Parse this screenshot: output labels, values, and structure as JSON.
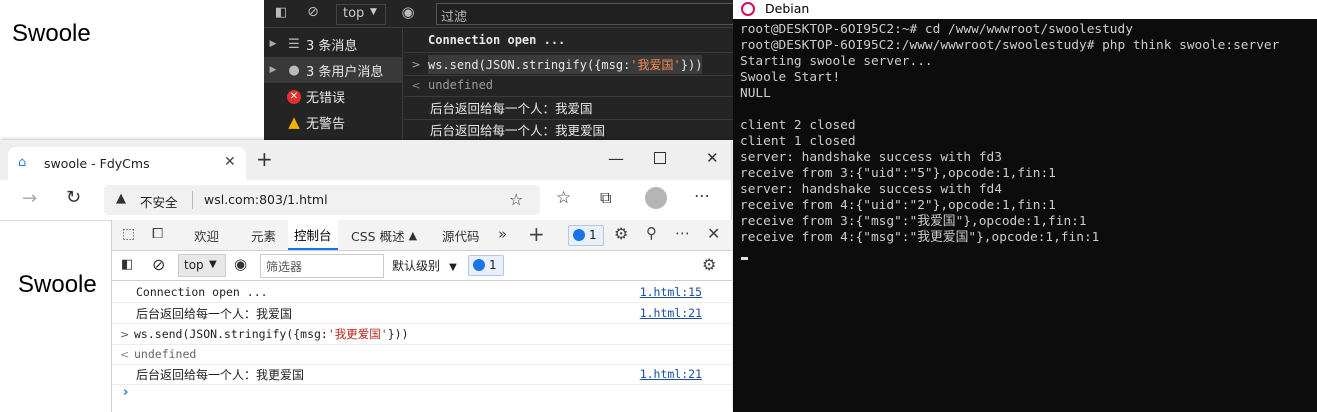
{
  "top_page": {
    "title": "Swoole"
  },
  "dark_devtools": {
    "toolbar": {
      "context": "top",
      "filter_placeholder": "过滤"
    },
    "sidebar": [
      {
        "label": "3 条消息",
        "icon": "list-icon"
      },
      {
        "label": "3 条用户消息",
        "icon": "user-icon",
        "selected": true
      },
      {
        "label": "无错误",
        "icon": "error-icon"
      },
      {
        "label": "无警告",
        "icon": "warning-icon"
      }
    ],
    "messages": [
      {
        "text": "Connection open ...",
        "kind": "log-bold"
      },
      {
        "prefix": ">",
        "code_pre": "ws.send(JSON.stringify({msg:",
        "code_str": "'我爱国'",
        "code_post": "}))",
        "kind": "input"
      },
      {
        "prefix": "<",
        "text": "undefined",
        "kind": "result"
      },
      {
        "text": "后台返回给每一个人：我爱国",
        "kind": "log"
      },
      {
        "text": "后台返回给每一个人：我更爱国",
        "kind": "log"
      }
    ]
  },
  "terminal": {
    "title": "Debian",
    "lines": [
      "root@DESKTOP-6OI95C2:~# cd /www/wwwroot/swoolestudy",
      "root@DESKTOP-6OI95C2:/www/wwwroot/swoolestudy# php think swoole:server",
      "Starting swoole server...",
      "Swoole Start!",
      "NULL",
      "",
      "client 2 closed",
      "client 1 closed",
      "server: handshake success with fd3",
      "receive from 3:{\"uid\":\"5\"},opcode:1,fin:1",
      "server: handshake success with fd4",
      "receive from 4:{\"uid\":\"2\"},opcode:1,fin:1",
      "receive from 3:{\"msg\":\"我爱国\"},opcode:1,fin:1",
      "receive from 4:{\"msg\":\"我更爱国\"},opcode:1,fin:1"
    ]
  },
  "browser": {
    "tab_title": "swoole - FdyCms",
    "security_label": "不安全",
    "url": "wsl.com:803/1.html",
    "page_title": "Swoole",
    "devtools": {
      "tabs": [
        "欢迎",
        "元素",
        "控制台",
        "CSS 概述",
        "源代码"
      ],
      "active_tab": "控制台",
      "issues_count": "1",
      "context": "top",
      "filter_placeholder": "筛选器",
      "levels": "默认级别",
      "console": [
        {
          "text": "Connection open ...",
          "source": "1.html:15",
          "kind": "log-mono"
        },
        {
          "text": "后台返回给每一个人：我爱国",
          "source": "1.html:21",
          "kind": "log"
        },
        {
          "prefix": ">",
          "code_pre": "ws.send(JSON.stringify({msg:",
          "code_str": "'我更爱国'",
          "code_post": "}))",
          "kind": "input"
        },
        {
          "prefix": "<",
          "text": "undefined",
          "kind": "result"
        },
        {
          "text": "后台返回给每一个人：我更爱国",
          "source": "1.html:21",
          "kind": "log"
        }
      ]
    }
  }
}
